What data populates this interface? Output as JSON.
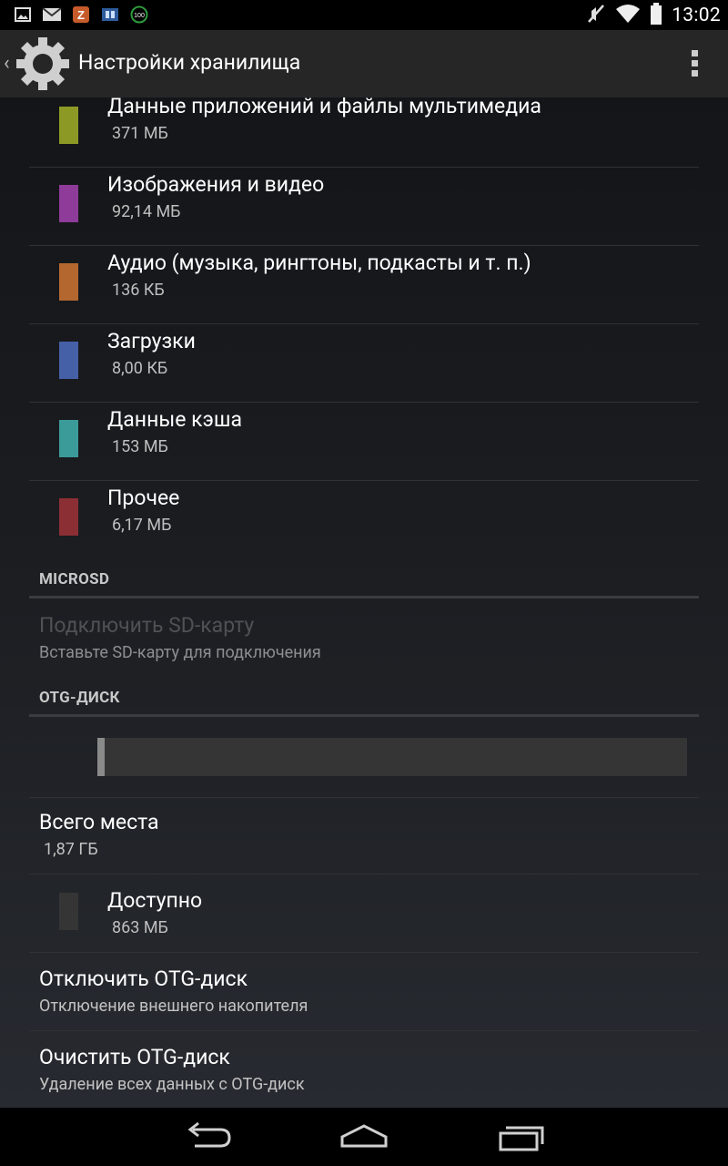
{
  "status_bar": {
    "time": "13:02",
    "left_icons": [
      "image-notification-icon",
      "gmail-icon",
      "z-app-icon",
      "app-notification-icon",
      "battery-saver-100-icon"
    ],
    "right_icons": [
      "mute-icon",
      "wifi-icon",
      "battery-icon"
    ]
  },
  "action_bar": {
    "title": "Настройки хранилища",
    "icon": "gear-icon",
    "overflow_icon": "overflow-menu-icon"
  },
  "storage_items": [
    {
      "title": "Данные приложений и файлы мультимедиа",
      "value": "371 МБ",
      "color": "#8c9a25"
    },
    {
      "title": "Изображения и видео",
      "value": "92,14 МБ",
      "color": "#8e3b99"
    },
    {
      "title": "Аудио (музыка, рингтоны, подкасты и т. п.)",
      "value": "136 КБ",
      "color": "#b4682f"
    },
    {
      "title": "Загрузки",
      "value": "8,00 КБ",
      "color": "#4660a8"
    },
    {
      "title": "Данные кэша",
      "value": "153 МБ",
      "color": "#3a9b99"
    },
    {
      "title": "Прочее",
      "value": "6,17 МБ",
      "color": "#8c2f35"
    }
  ],
  "microsd": {
    "header": "MICROSD",
    "mount_title": "Подключить SD-карту",
    "mount_subtitle": "Вставьте SD-карту для подключения"
  },
  "otg": {
    "header": "OTG-ДИСК",
    "used_fraction": 0.013,
    "total_title": "Всего места",
    "total_value": "1,87 ГБ",
    "available_title": "Доступно",
    "available_value": "863 МБ",
    "available_color": "#353535",
    "unmount_title": "Отключить OTG-диск",
    "unmount_subtitle": "Отключение внешнего накопителя",
    "erase_title": "Очистить OTG-диск",
    "erase_subtitle": "Удаление всех данных с OTG-диск"
  },
  "nav_bar": {
    "buttons": [
      "back-icon",
      "home-icon",
      "recents-icon"
    ]
  }
}
